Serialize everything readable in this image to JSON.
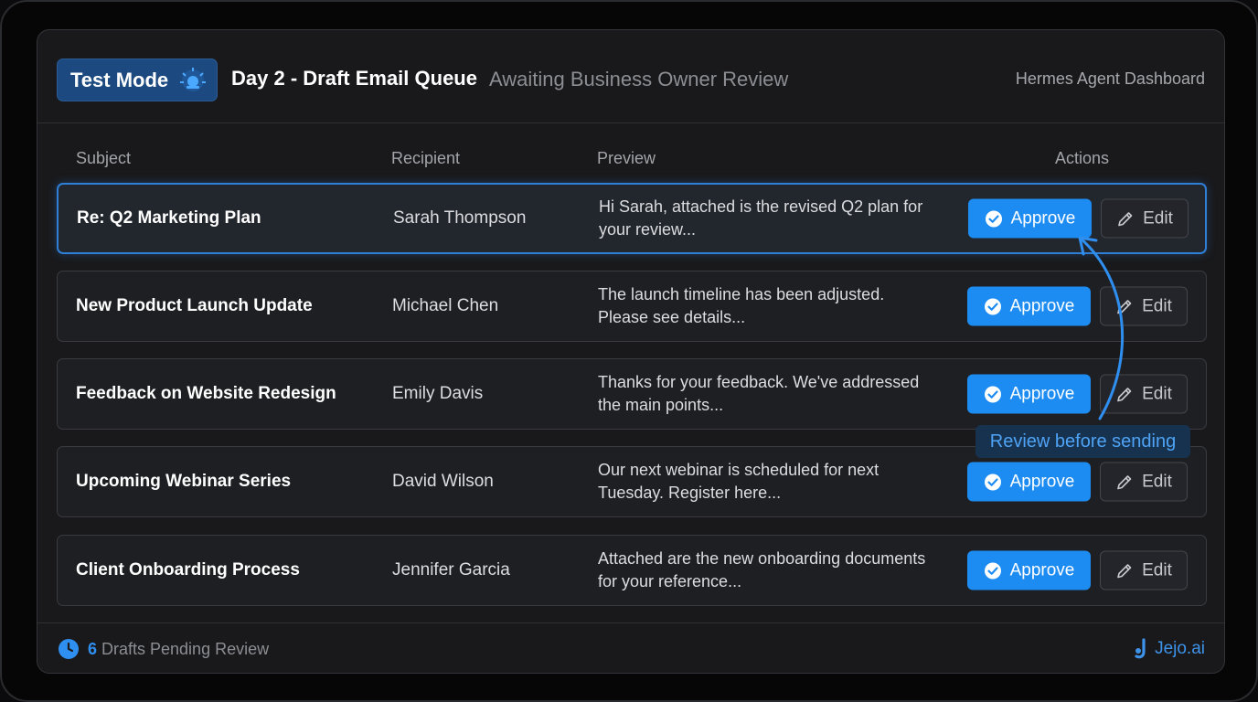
{
  "header": {
    "mode_badge": "Test Mode",
    "title": "Day 2 - Draft Email Queue",
    "subtitle": "Awaiting Business Owner Review",
    "dashboard_name": "Hermes Agent Dashboard"
  },
  "table": {
    "columns": [
      "Subject",
      "Recipient",
      "Preview",
      "Actions"
    ],
    "rows": [
      {
        "subject": "Re: Q2 Marketing Plan",
        "recipient": "Sarah Thompson",
        "preview": "Hi Sarah, attached is the revised Q2 plan for your review...",
        "approve": "Approve",
        "edit": "Edit",
        "selected": true
      },
      {
        "subject": "New Product Launch Update",
        "recipient": "Michael Chen",
        "preview": "The launch timeline has been adjusted. Please see details...",
        "approve": "Approve",
        "edit": "Edit"
      },
      {
        "subject": "Feedback on Website Redesign",
        "recipient": "Emily Davis",
        "preview": "Thanks for your feedback. We've addressed the main points...",
        "approve": "Approve",
        "edit": "Edit"
      },
      {
        "subject": "Upcoming Webinar Series",
        "recipient": "David Wilson",
        "preview": "Our next webinar is scheduled for next Tuesday. Register here...",
        "approve": "Approve",
        "edit": "Edit"
      },
      {
        "subject": "Client Onboarding Process",
        "recipient": "Jennifer Garcia",
        "preview": "Attached are the new onboarding documents for your reference...",
        "approve": "Approve",
        "edit": "Edit"
      }
    ]
  },
  "annotation": {
    "label": "Review before sending"
  },
  "footer": {
    "pending_count": "6",
    "pending_label": " Drafts Pending Review",
    "brand": "Jejo.ai"
  },
  "icons": {
    "mode": "siren-icon",
    "approve": "check-circle-icon",
    "edit": "pencil-icon",
    "footer": "clock-icon",
    "brand": "jejo-logo-icon"
  },
  "colors": {
    "accent": "#1d8cf2",
    "badge": "#1c4a80",
    "annotation": "#4ea3f5"
  }
}
